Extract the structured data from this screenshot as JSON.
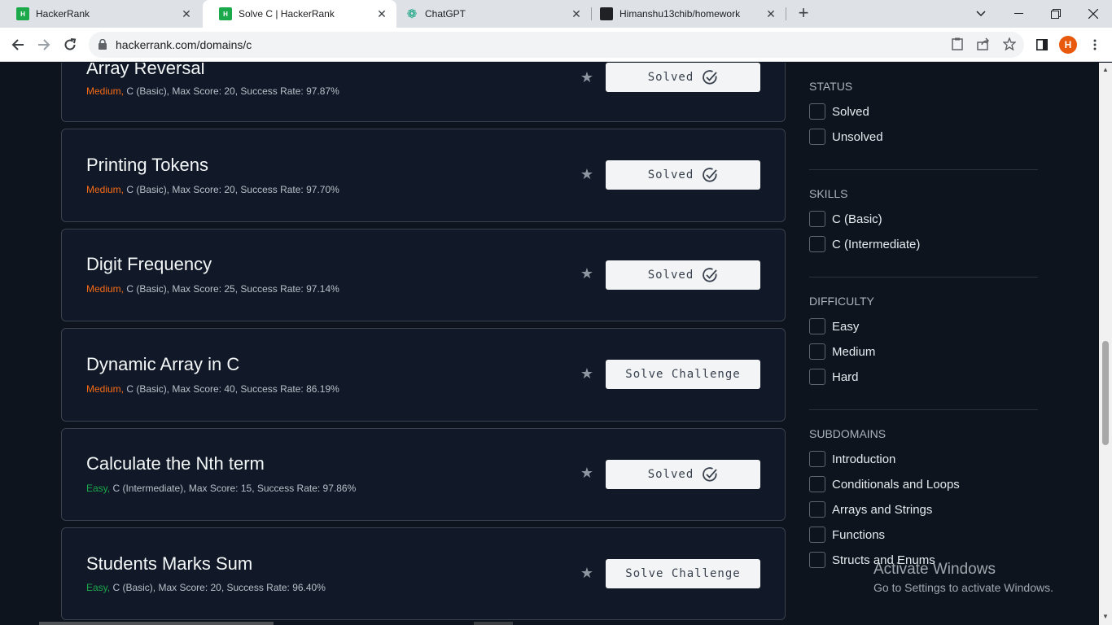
{
  "browser": {
    "tabs": [
      {
        "title": "HackerRank",
        "icon": "hackerrank-logo-icon",
        "active": false
      },
      {
        "title": "Solve C | HackerRank",
        "icon": "hackerrank-logo-icon",
        "active": true
      },
      {
        "title": "ChatGPT",
        "icon": "chatgpt-logo-icon",
        "active": false
      },
      {
        "title": "Himanshu13chib/homework",
        "icon": "github-logo-icon",
        "active": false
      }
    ],
    "favicon_text": "H",
    "url": "hackerrank.com/domains/c",
    "profile_initial": "H",
    "accent": "#e8590c"
  },
  "challenges": [
    {
      "title": "Array Reversal",
      "difficulty": "Medium,",
      "meta": " C (Basic), Max Score: 20, Success Rate: 97.87%",
      "button": "Solved",
      "solved": true
    },
    {
      "title": "Printing Tokens",
      "difficulty": "Medium,",
      "meta": " C (Basic), Max Score: 20, Success Rate: 97.70%",
      "button": "Solved",
      "solved": true
    },
    {
      "title": "Digit Frequency",
      "difficulty": "Medium,",
      "meta": " C (Basic), Max Score: 25, Success Rate: 97.14%",
      "button": "Solved",
      "solved": true
    },
    {
      "title": "Dynamic Array in C",
      "difficulty": "Medium,",
      "meta": " C (Basic), Max Score: 40, Success Rate: 86.19%",
      "button": "Solve Challenge",
      "solved": false
    },
    {
      "title": "Calculate the Nth term",
      "difficulty": "Easy,",
      "meta": " C (Intermediate), Max Score: 15, Success Rate: 97.86%",
      "button": "Solved",
      "solved": true
    },
    {
      "title": "Students Marks Sum",
      "difficulty": "Easy,",
      "meta": " C (Basic), Max Score: 20, Success Rate: 96.40%",
      "button": "Solve Challenge",
      "solved": false
    }
  ],
  "filters": {
    "status": {
      "title": "STATUS",
      "items": [
        "Solved",
        "Unsolved"
      ]
    },
    "skills": {
      "title": "SKILLS",
      "items": [
        "C (Basic)",
        "C (Intermediate)"
      ]
    },
    "difficulty": {
      "title": "DIFFICULTY",
      "items": [
        "Easy",
        "Medium",
        "Hard"
      ]
    },
    "subdomains": {
      "title": "SUBDOMAINS",
      "items": [
        "Introduction",
        "Conditionals and Loops",
        "Arrays and Strings",
        "Functions",
        "Structs and Enums"
      ]
    }
  },
  "watermark": {
    "line1": "Activate Windows",
    "line2": "Go to Settings to activate Windows."
  },
  "colors": {
    "medium": "#f76b15",
    "easy": "#1ba94c",
    "background": "#0e141e"
  }
}
